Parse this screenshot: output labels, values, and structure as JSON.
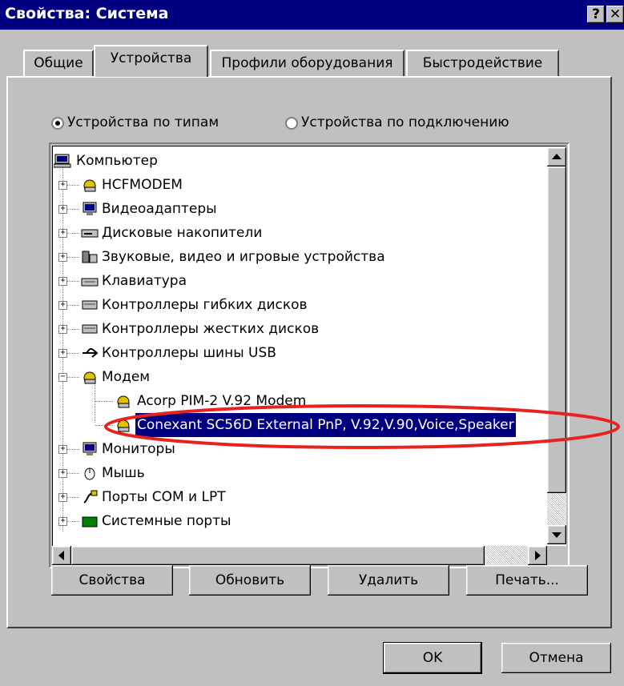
{
  "window": {
    "title": "Свойства: Система",
    "help_button": "?",
    "close_button": "✕"
  },
  "tabs": [
    {
      "label": "Общие",
      "active": false
    },
    {
      "label": "Устройства",
      "active": true
    },
    {
      "label": "Профили оборудования",
      "active": false
    },
    {
      "label": "Быстродействие",
      "active": false
    }
  ],
  "view_options": {
    "by_type": {
      "label": "Устройства по типам",
      "checked": true
    },
    "by_connection": {
      "label": "Устройства по подключению",
      "checked": false
    }
  },
  "tree": {
    "root": {
      "label": "Компьютер",
      "icon": "computer-icon"
    },
    "items": [
      {
        "label": "HCFMODEM",
        "icon": "modem-icon",
        "expander": "+"
      },
      {
        "label": "Видеоадаптеры",
        "icon": "monitor-icon",
        "expander": "+"
      },
      {
        "label": "Дисковые накопители",
        "icon": "disk-drive-icon",
        "expander": "+"
      },
      {
        "label": "Звуковые, видео и игровые устройства",
        "icon": "sound-device-icon",
        "expander": "+"
      },
      {
        "label": "Клавиатура",
        "icon": "keyboard-icon",
        "expander": "+"
      },
      {
        "label": "Контроллеры гибких дисков",
        "icon": "floppy-controller-icon",
        "expander": "+"
      },
      {
        "label": "Контроллеры жестких дисков",
        "icon": "hdd-controller-icon",
        "expander": "+"
      },
      {
        "label": "Контроллеры шины USB",
        "icon": "usb-icon",
        "expander": "+"
      },
      {
        "label": "Модем",
        "icon": "modem-icon",
        "expander": "−"
      },
      {
        "label": "Мониторы",
        "icon": "monitor-icon",
        "expander": "+"
      },
      {
        "label": "Мышь",
        "icon": "mouse-icon",
        "expander": "+"
      },
      {
        "label": "Порты COM и LPT",
        "icon": "port-icon",
        "expander": "+"
      },
      {
        "label": "Системные порты",
        "icon": "system-port-icon",
        "expander": "+"
      }
    ],
    "modem_children": [
      {
        "label": "Acorp PIM-2 V.92 Modem",
        "icon": "modem-icon",
        "selected": false
      },
      {
        "label": "Conexant SC56D External PnP, V.92,V.90,Voice,Speaker",
        "icon": "modem-icon",
        "selected": true
      }
    ]
  },
  "buttons": {
    "properties": "Свойства",
    "refresh": "Обновить",
    "remove": "Удалить",
    "print": "Печать...",
    "ok": "OK",
    "cancel": "Отмена"
  },
  "colors": {
    "titlebar": "#000080",
    "selection": "#000080",
    "annotation": "#e8231f",
    "face": "#c0c0c0"
  }
}
